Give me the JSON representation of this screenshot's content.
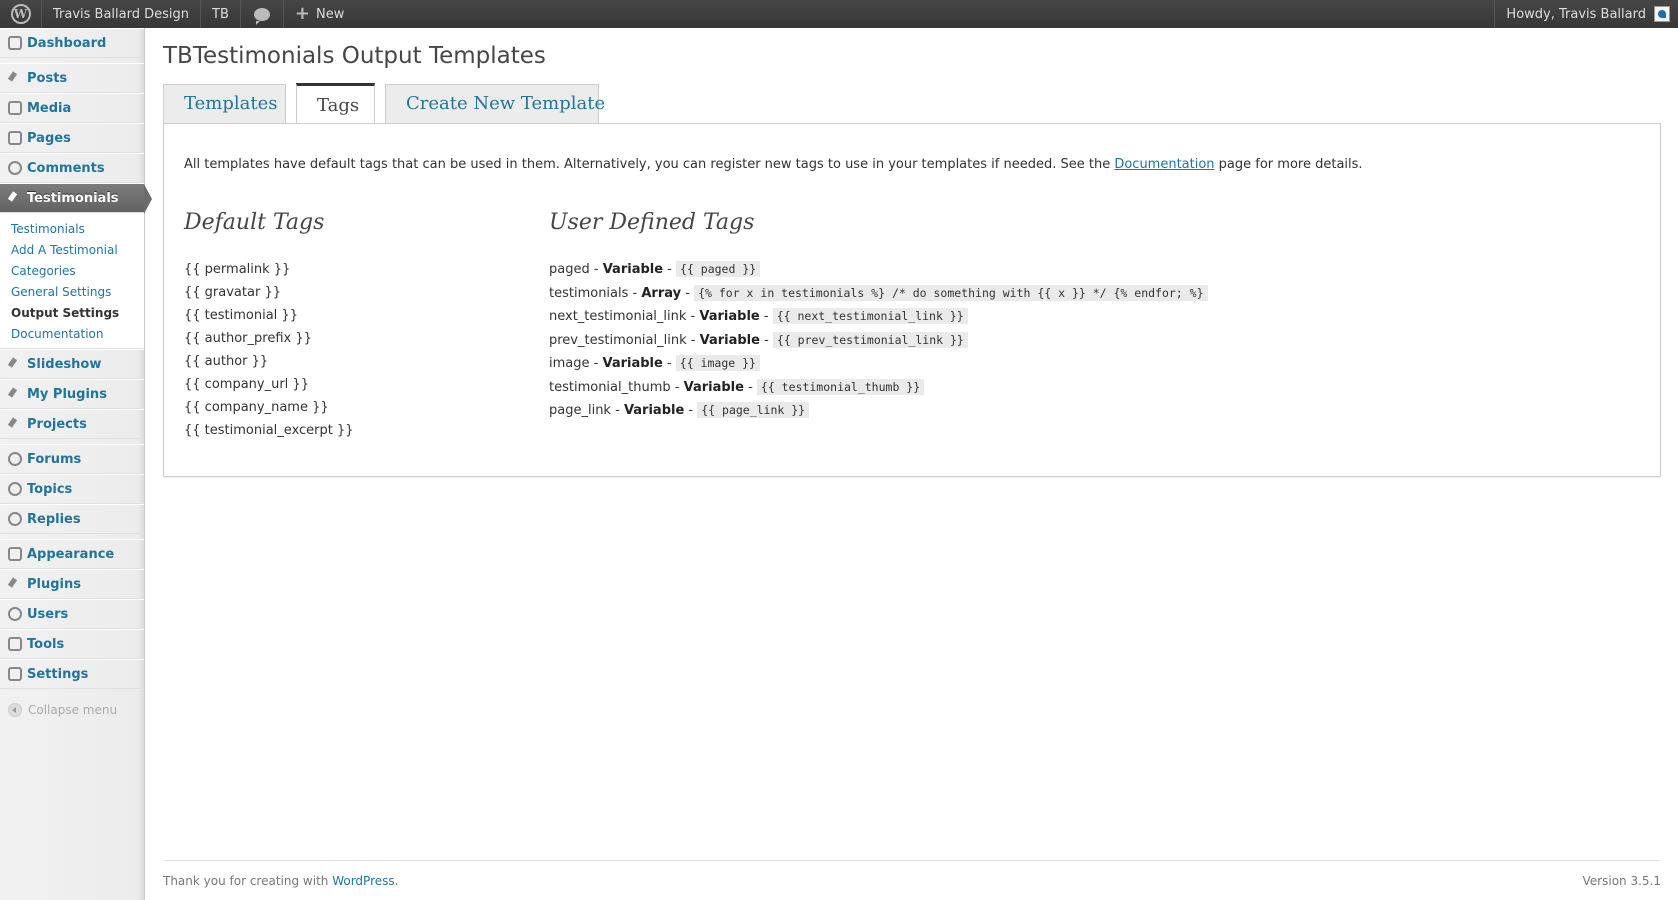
{
  "adminbar": {
    "site_name": "Travis Ballard Design",
    "tb_label": "TB",
    "new_label": "New",
    "howdy": "Howdy, Travis Ballard"
  },
  "menu": {
    "dashboard": "Dashboard",
    "posts": "Posts",
    "media": "Media",
    "pages": "Pages",
    "comments": "Comments",
    "testimonials": "Testimonials",
    "submenu": [
      "Testimonials",
      "Add A Testimonial",
      "Categories",
      "General Settings",
      "Output Settings",
      "Documentation"
    ],
    "slideshow": "Slideshow",
    "my_plugins": "My Plugins",
    "projects": "Projects",
    "forums": "Forums",
    "topics": "Topics",
    "replies": "Replies",
    "appearance": "Appearance",
    "plugins": "Plugins",
    "users": "Users",
    "tools": "Tools",
    "settings": "Settings",
    "collapse": "Collapse menu"
  },
  "page": {
    "title": "TBTestimonials Output Templates",
    "tabs": [
      "Templates",
      "Tags",
      "Create New Template"
    ],
    "intro_text": "All templates have default tags that can be used in them. Alternatively, you can register new tags to use in your templates if needed. See the ",
    "intro_link": "Documentation",
    "intro_after": " page for more details.",
    "default_heading": "Default Tags",
    "user_heading": "User Defined Tags",
    "default_tags": [
      "{{ permalink }}",
      "{{ gravatar }}",
      "{{ testimonial }}",
      "{{ author_prefix }}",
      "{{ author }}",
      "{{ company_url }}",
      "{{ company_name }}",
      "{{ testimonial_excerpt }}"
    ],
    "user_tags": [
      {
        "name": "paged",
        "type": "Variable",
        "code": "{{ paged }}"
      },
      {
        "name": "testimonials",
        "type": "Array",
        "code": "{% for x in testimonials %} /* do something with {{ x }} */ {% endfor; %}"
      },
      {
        "name": "next_testimonial_link",
        "type": "Variable",
        "code": "{{ next_testimonial_link }}"
      },
      {
        "name": "prev_testimonial_link",
        "type": "Variable",
        "code": "{{ prev_testimonial_link }}"
      },
      {
        "name": "image",
        "type": "Variable",
        "code": "{{ image }}"
      },
      {
        "name": "testimonial_thumb",
        "type": "Variable",
        "code": "{{ testimonial_thumb }}"
      },
      {
        "name": "page_link",
        "type": "Variable",
        "code": "{{ page_link }}"
      }
    ],
    "separator": " - "
  },
  "footer": {
    "thanks": "Thank you for creating with ",
    "link": "WordPress",
    "period": ".",
    "version": "Version 3.5.1"
  },
  "colors": {
    "link": "#21759b",
    "adminbar": "#464646",
    "current_menu": "#6c6c6c"
  }
}
